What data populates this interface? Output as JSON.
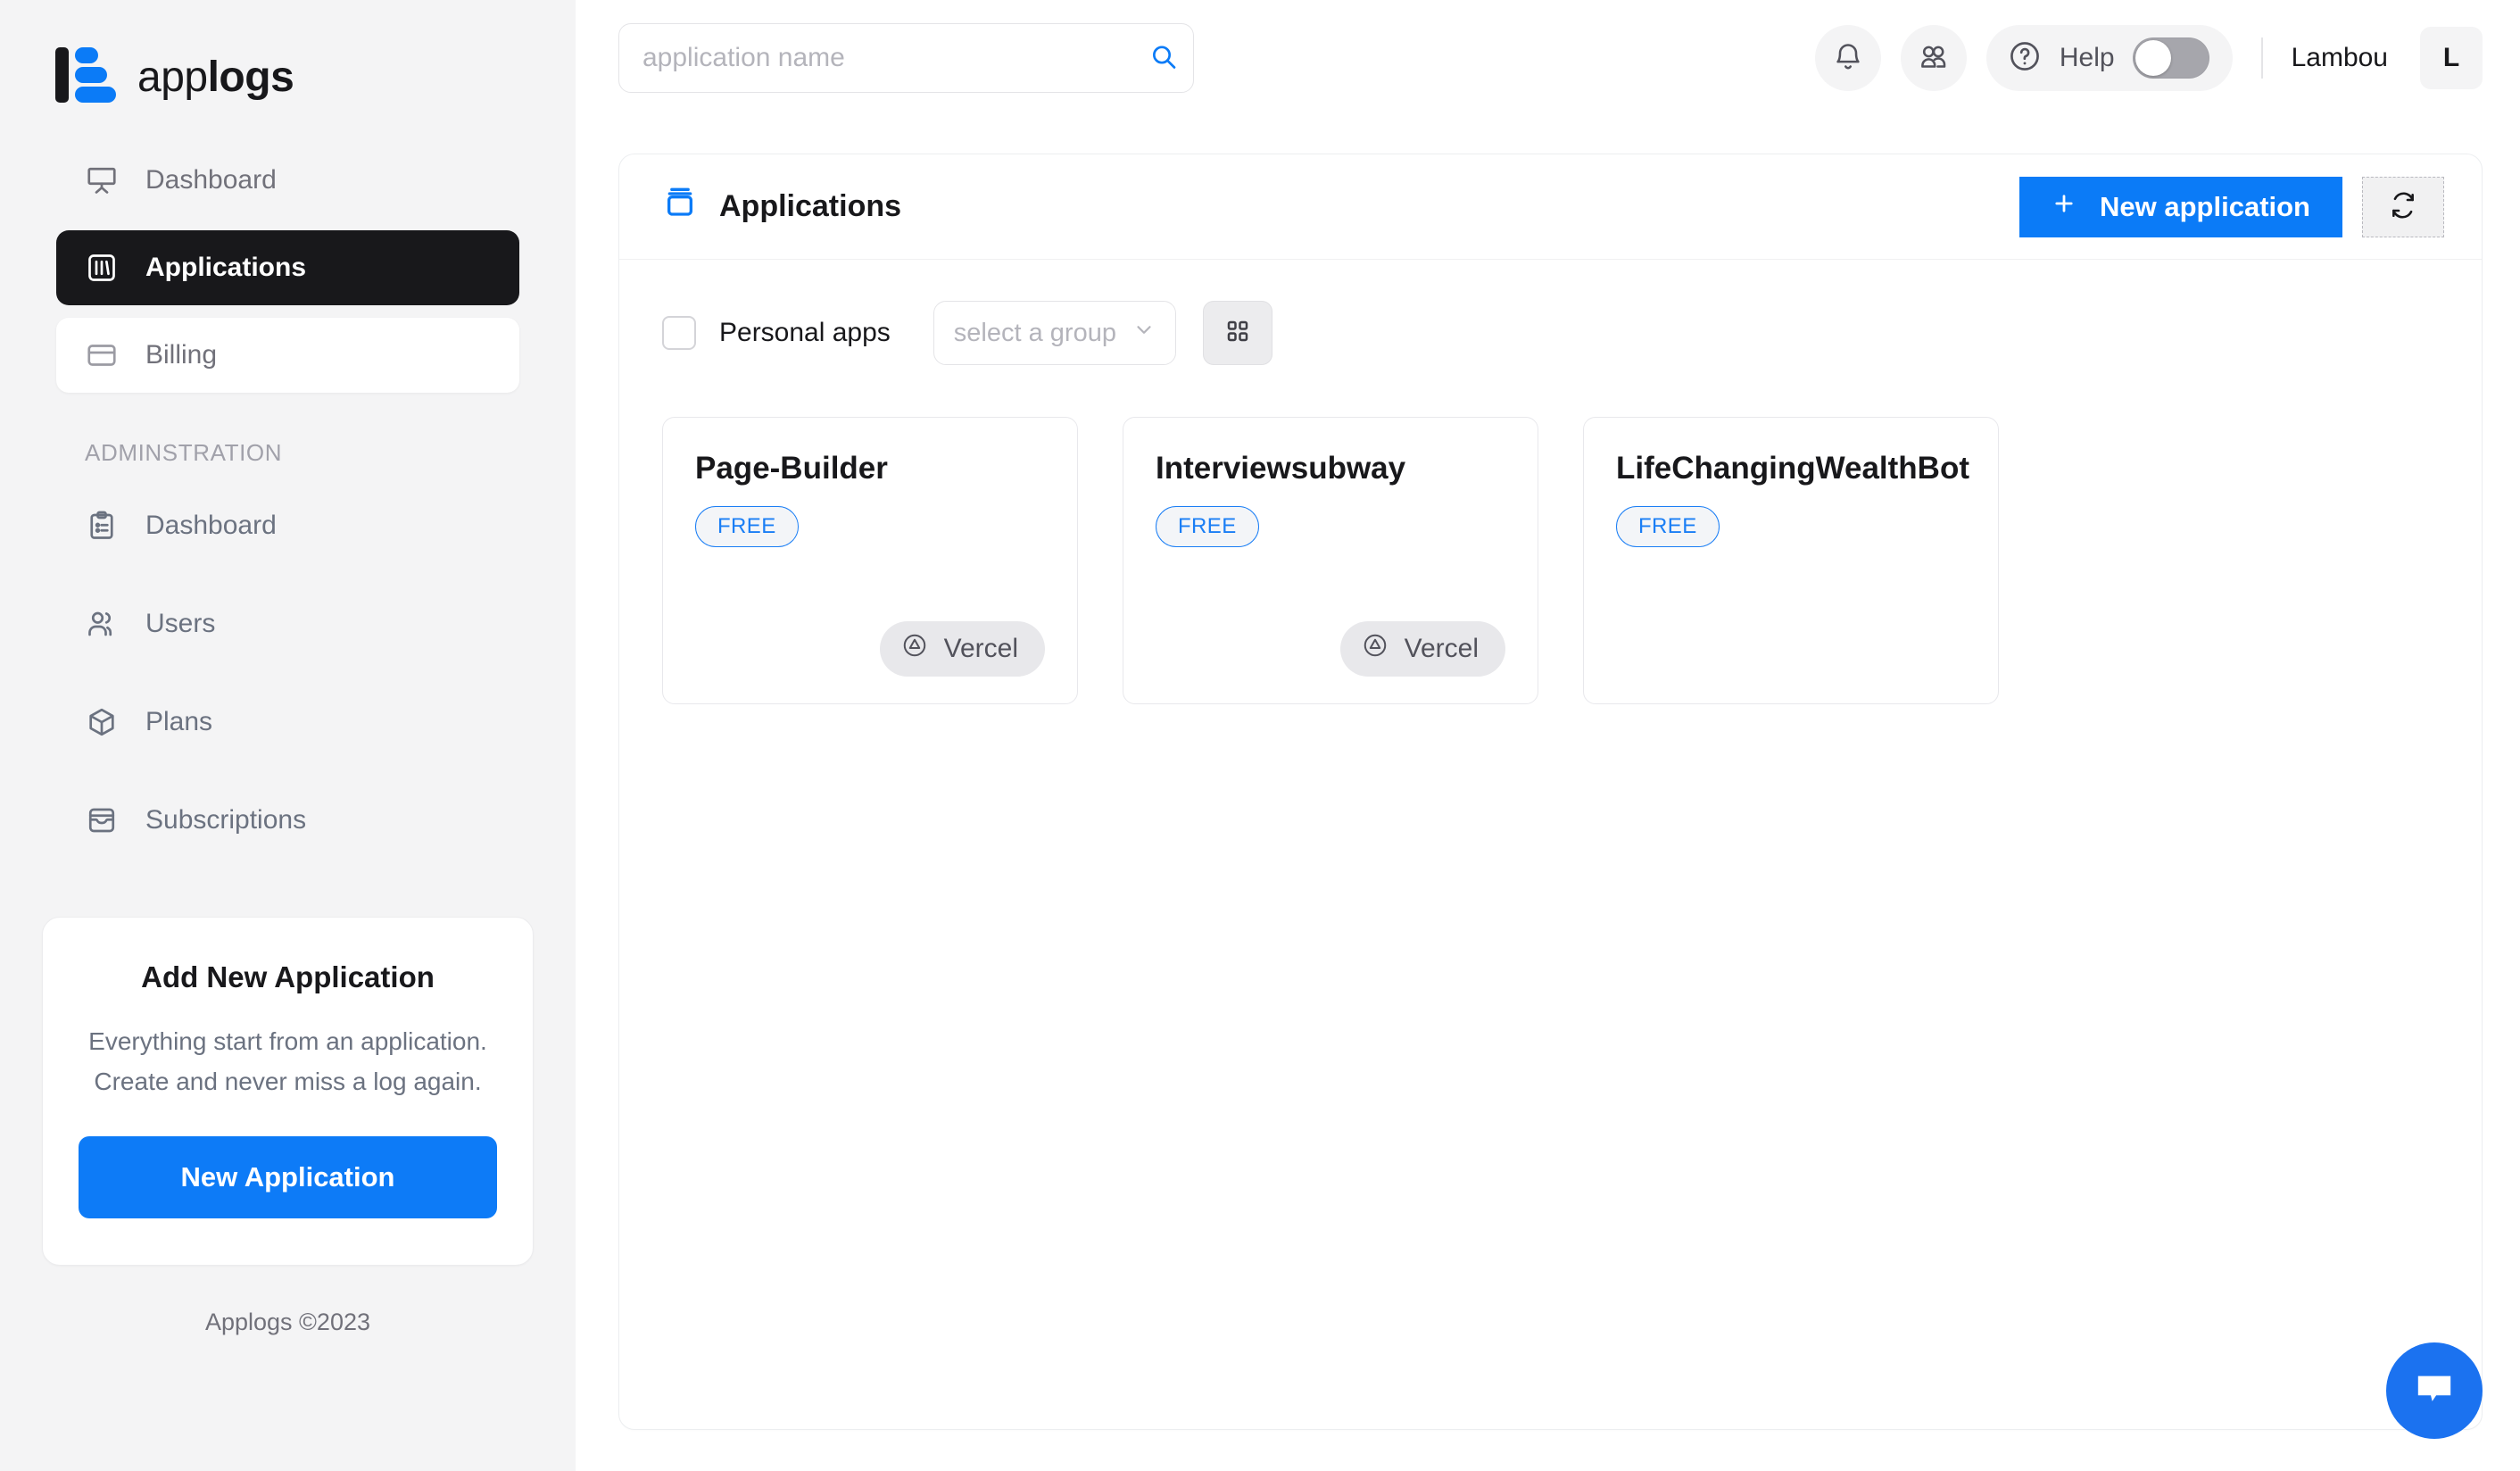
{
  "brand": {
    "light": "app",
    "bold": "logs"
  },
  "sidebar": {
    "nav": [
      {
        "label": "Dashboard",
        "icon": "presentation-icon",
        "state": "default"
      },
      {
        "label": "Applications",
        "icon": "columns-icon",
        "state": "active"
      },
      {
        "label": "Billing",
        "icon": "credit-card-icon",
        "state": "card"
      }
    ],
    "section_label": "ADMINSTRATION",
    "admin_nav": [
      {
        "label": "Dashboard",
        "icon": "clipboard-list-icon"
      },
      {
        "label": "Users",
        "icon": "users-icon"
      },
      {
        "label": "Plans",
        "icon": "box-icon"
      },
      {
        "label": "Subscriptions",
        "icon": "inbox-icon"
      }
    ],
    "promo": {
      "title": "Add New Application",
      "text": "Everything start from an application. Create and never miss a log again.",
      "button": "New Application"
    },
    "footer": "Applogs ©2023"
  },
  "topbar": {
    "search": {
      "value": "",
      "placeholder": "application name",
      "icon": "search-icon"
    },
    "notifications_icon": "bell-icon",
    "team_icon": "team-icon",
    "help": {
      "label": "Help",
      "icon": "question-circle-icon",
      "toggle_on": false
    },
    "user": {
      "name": "Lambou",
      "avatar_initial": "L"
    }
  },
  "panel": {
    "title": "Applications",
    "title_icon": "archive-box-icon",
    "new_application_label": "New application",
    "new_application_icon": "plus-icon",
    "refresh_icon": "refresh-icon",
    "filters": {
      "personal_apps_label": "Personal apps",
      "personal_apps_checked": false,
      "group_select": {
        "value": "select a group",
        "chevron": "chevron-down-icon"
      },
      "view_toggle_icon": "grid-icon"
    },
    "applications": [
      {
        "name": "Page-Builder",
        "plan": "FREE",
        "provider": "Vercel",
        "provider_icon": "vercel-icon",
        "has_provider": true
      },
      {
        "name": "Interviewsubway",
        "plan": "FREE",
        "provider": "Vercel",
        "provider_icon": "vercel-icon",
        "has_provider": true
      },
      {
        "name": "LifeChangingWealthBot",
        "plan": "FREE",
        "provider": "",
        "provider_icon": "",
        "has_provider": false
      }
    ]
  },
  "chat": {
    "icon": "chat-bubble-icon"
  },
  "colors": {
    "accent": "#0b7bf7",
    "active_bg": "#18181b",
    "sidebar_bg": "#f4f4f5",
    "badge": "#1a7ef5"
  }
}
